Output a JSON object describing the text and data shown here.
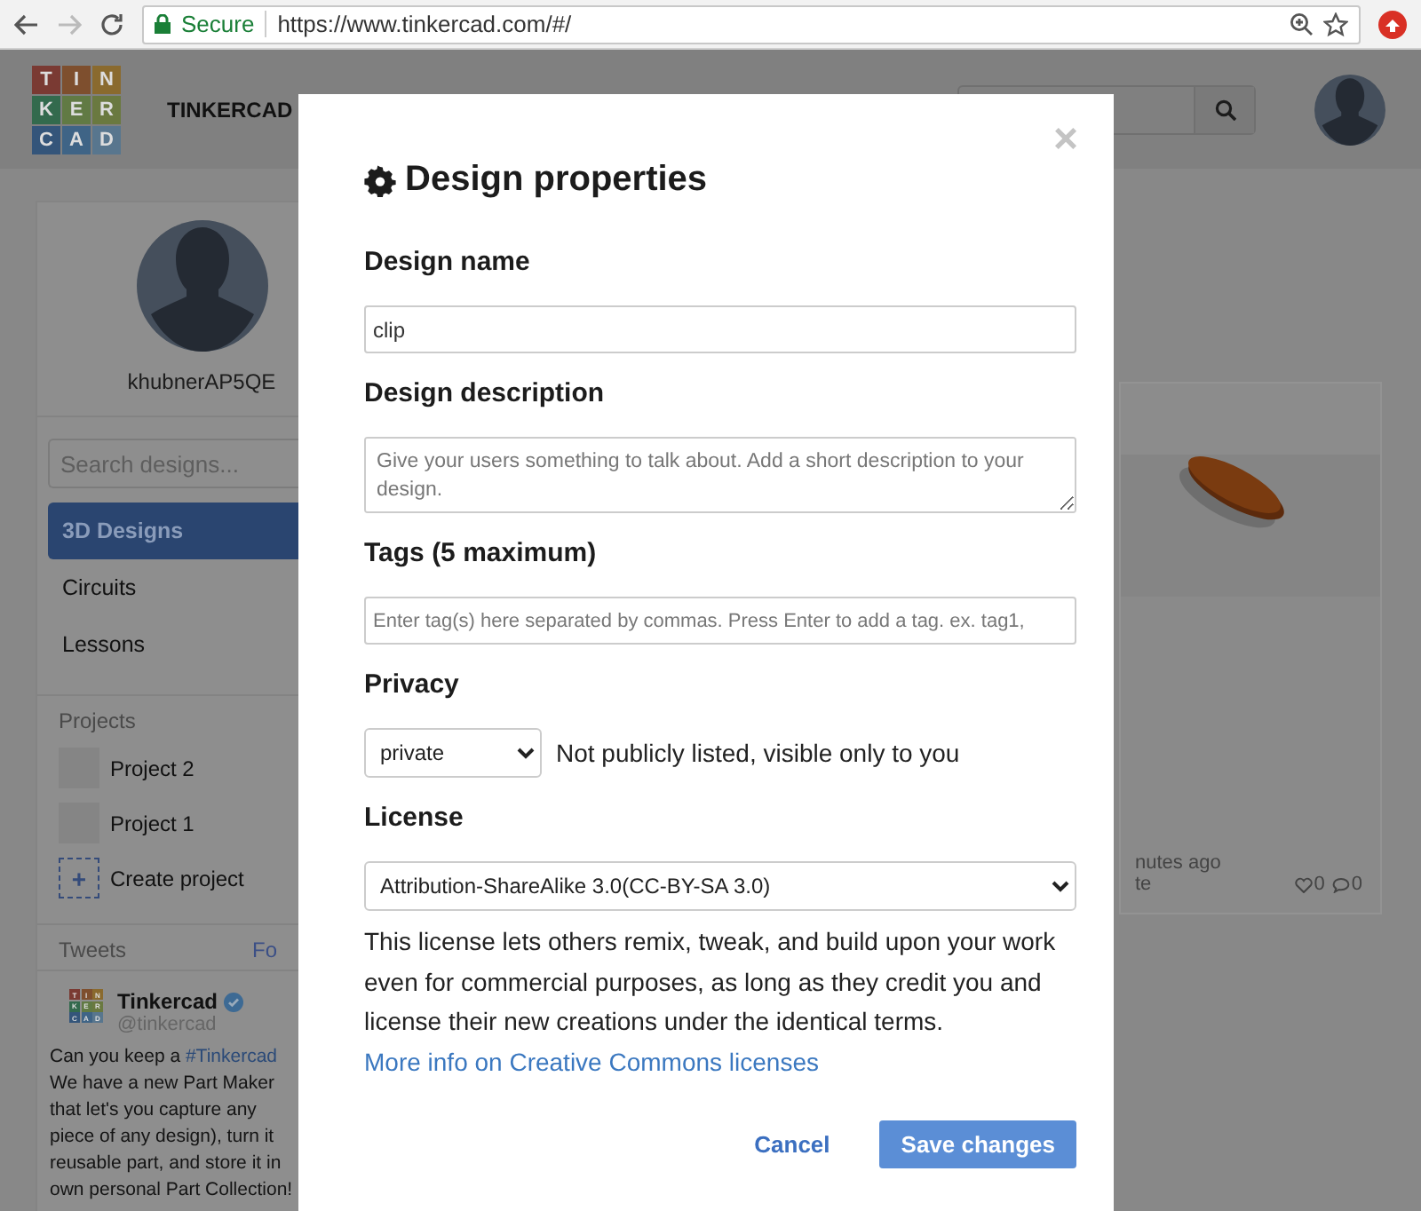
{
  "browser": {
    "secure_label": "Secure",
    "url": "https://www.tinkercad.com/#/"
  },
  "header": {
    "logo_letters": [
      "T",
      "I",
      "N",
      "K",
      "E",
      "R",
      "C",
      "A",
      "D"
    ],
    "brand": "TINKERCAD"
  },
  "sidebar": {
    "username": "khubnerAP5QE",
    "search": {
      "placeholder": "Search designs..."
    },
    "nav": [
      {
        "label": "3D Designs",
        "selected": true
      },
      {
        "label": "Circuits",
        "selected": false
      },
      {
        "label": "Lessons",
        "selected": false
      }
    ],
    "projects_title": "Projects",
    "projects": [
      {
        "kind": "project",
        "label": "Project 2"
      },
      {
        "kind": "project",
        "label": "Project 1"
      },
      {
        "kind": "create",
        "label": "Create project",
        "icon": "+"
      }
    ],
    "tweets": {
      "title": "Tweets",
      "follow": "Fo",
      "author": "Tinkercad",
      "handle": "@tinkercad",
      "logo_letters": [
        "T",
        "I",
        "N",
        "K",
        "E",
        "R",
        "C",
        "A",
        "D"
      ],
      "lines": [
        "Can you keep a **#Tinkercad**",
        "We have a new Part Maker",
        "that let's you capture any",
        "piece of any design), turn it",
        "reusable part, and store it in",
        "own personal Part Collection!"
      ]
    }
  },
  "design_card": {
    "time": "nutes ago",
    "line_2": "te",
    "likes": "0",
    "comments": "0"
  },
  "modal": {
    "close": "×",
    "title": "Design properties",
    "name_label": "Design name",
    "name_value": "clip",
    "description_label": "Design description",
    "description_placeholder": "Give your users something to talk about. Add a short description to your design.",
    "tags_label": "Tags (5 maximum)",
    "tags_placeholder": "Enter tag(s) here separated by commas. Press Enter to add a tag. ex. tag1,",
    "privacy_label": "Privacy",
    "privacy_value": "private",
    "privacy_note": "Not publicly listed, visible only to you",
    "license_label": "License",
    "license_value": "Attribution-ShareAlike 3.0(CC-BY-SA 3.0)",
    "license_text": "This license lets others remix, tweak, and build upon your work even for commercial purposes, as long as they credit you and license their new creations under the identical terms.",
    "license_link": "More info on Creative Commons licenses",
    "buttons": [
      {
        "kind": "cancel",
        "label": "Cancel"
      },
      {
        "kind": "primary",
        "label": "Save changes"
      }
    ]
  }
}
